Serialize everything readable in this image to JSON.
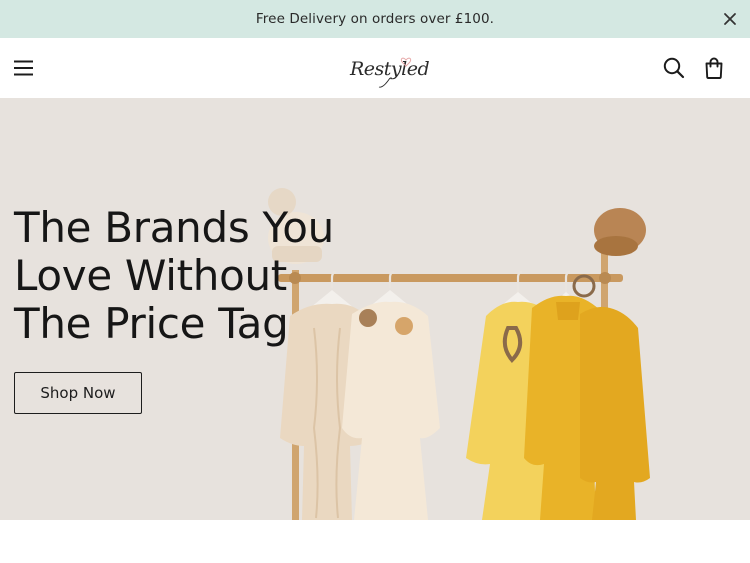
{
  "announcement": {
    "text": "Free Delivery on orders over £100.",
    "close_icon": "close-icon"
  },
  "header": {
    "menu_icon": "hamburger-menu-icon",
    "logo_text": "Restyled",
    "search_icon": "search-icon",
    "cart_icon": "shopping-bag-icon"
  },
  "hero": {
    "title_lines": [
      "The Brands You",
      "Love Without",
      "The Price Tag"
    ],
    "cta_label": "Shop Now",
    "image_name": "clothing-rack-image"
  },
  "colors": {
    "announcement_bg": "#d4e8e2",
    "hero_bg": "#e7e2dd",
    "text": "#1c1c1c"
  }
}
